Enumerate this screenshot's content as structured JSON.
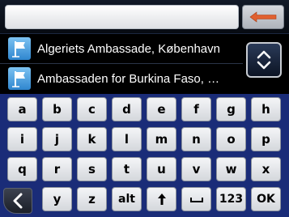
{
  "search": {
    "value": "",
    "placeholder": ""
  },
  "toolbar": {
    "back_icon": "left-arrow-icon",
    "accent_color": "#e06030"
  },
  "results": [
    {
      "label": "Algeriets Ambassade, København",
      "icon": "flag-icon"
    },
    {
      "label": "Ambassaden for Burkina Faso, …",
      "icon": "flag-icon"
    }
  ],
  "scroll": {
    "icon": "up-down-chevron-icon"
  },
  "keyboard": {
    "row1": [
      "a",
      "b",
      "c",
      "d",
      "e",
      "f",
      "g",
      "h"
    ],
    "row2": [
      "i",
      "j",
      "k",
      "l",
      "m",
      "n",
      "o",
      "p"
    ],
    "row3": [
      "q",
      "r",
      "s",
      "t",
      "u",
      "v",
      "w",
      "x"
    ],
    "row4": {
      "keys": [
        "y",
        "z",
        "alt"
      ],
      "shift_icon": "up-arrow-icon",
      "space_icon": "space-icon",
      "numbers": "123",
      "ok": "OK",
      "left_icon": "chevron-left-icon"
    }
  }
}
